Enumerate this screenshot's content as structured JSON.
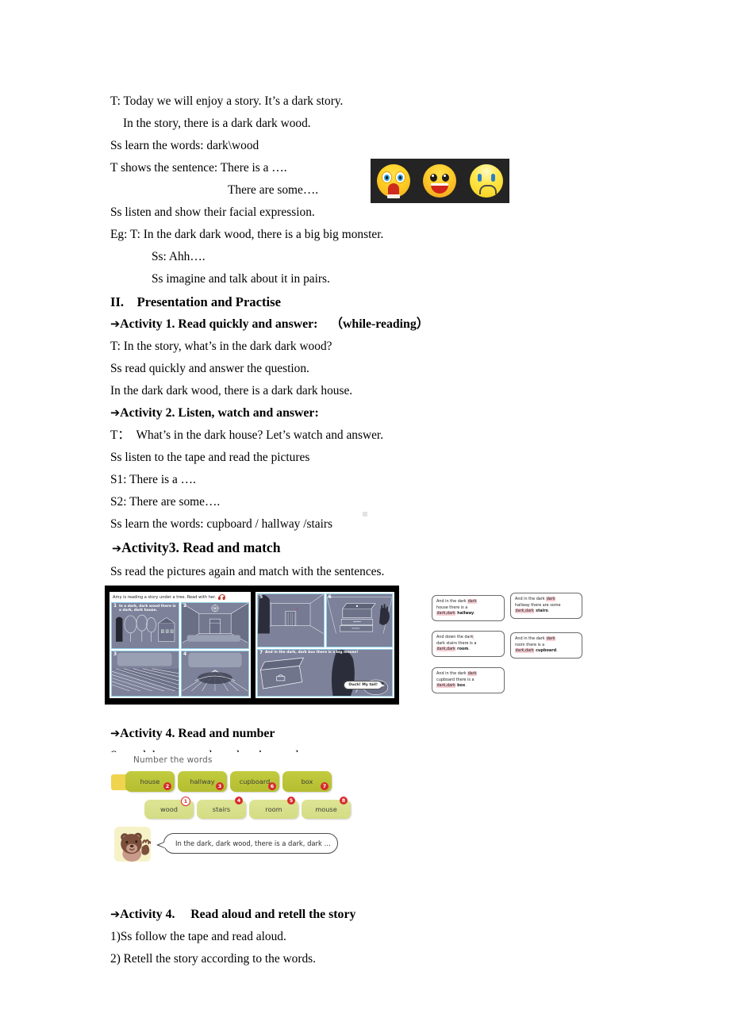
{
  "document": {
    "lines": [
      {
        "id": "l1",
        "text": "T: Today we will enjoy a story. It’s a dark story.",
        "indent": 0
      },
      {
        "id": "l2",
        "text": "In the story, there is a dark dark wood.",
        "indent": 1
      },
      {
        "id": "l3",
        "text": "Ss learn the words: dark\\wood",
        "indent": 0
      },
      {
        "id": "l4",
        "text": "T shows the sentence: There is a ….",
        "indent": 0
      },
      {
        "id": "l5",
        "text": "There are some….",
        "indent": 3
      },
      {
        "id": "l6",
        "text": "Ss listen and show their facial expression.",
        "indent": 0
      },
      {
        "id": "l7",
        "text": "Eg: T: In the dark dark wood, there is a big big monster.",
        "indent": 0
      },
      {
        "id": "l8",
        "text": "Ss: Ahh….",
        "indent": 2
      },
      {
        "id": "l9",
        "text": "Ss imagine and talk about it in pairs.",
        "indent": 2
      }
    ],
    "section_heading": "II. Presentation and Practise",
    "activity1": {
      "arrow": "➔",
      "heading": "Activity 1. Read quickly and answer: （while-reading）",
      "lines": [
        "T: In the story, what’s in the dark dark wood?",
        "Ss read quickly and answer the question.",
        "In the dark dark wood, there is a dark dark house."
      ]
    },
    "activity2": {
      "arrow": "➔",
      "heading": "Activity 2. Listen, watch and answer:",
      "lines": [
        "T： What’s in the dark house? Let’s watch and answer.",
        "Ss listen to the tape and read the pictures",
        "S1: There is a ….",
        "S2: There are some….",
        "Ss learn the words: cupboard / hallway /stairs"
      ]
    },
    "activity3": {
      "arrow": "➔",
      "heading": "Activity3. Read and match",
      "lines": [
        "Ss read the pictures again and match with the sentences."
      ]
    },
    "activity4a": {
      "arrow": "➔",
      "heading": "Activity 4. Read and number",
      "lines": [
        "Ss read the story and number the words."
      ]
    },
    "activity4b": {
      "arrow": "➔",
      "heading": "Activity 4.  Read aloud and retell the story",
      "lines": [
        "1)Ss follow the tape and read aloud.",
        "2) Retell the story according to the words."
      ]
    }
  },
  "emoji_strip": {
    "background": "#242424",
    "faces": [
      {
        "name": "screaming-face",
        "label": "screaming face"
      },
      {
        "name": "grinning-face",
        "label": "grinning face"
      },
      {
        "name": "confused-face",
        "label": "confused face"
      }
    ]
  },
  "comic": {
    "caption": "Amy is reading a story under a tree. Read with her.",
    "panels": [
      {
        "number": "1",
        "caption": "In a dark, dark wood there is a dark, dark house."
      },
      {
        "number": "2",
        "caption": ""
      },
      {
        "number": "3",
        "caption": ""
      },
      {
        "number": "4",
        "caption": ""
      },
      {
        "number": "5",
        "caption": ""
      },
      {
        "number": "6",
        "caption": ""
      },
      {
        "number": "7",
        "caption": "And in the dark, dark box there is a big mouse!"
      }
    ],
    "speech_bubble": "Ouch! My tail!"
  },
  "sentence_cards": [
    {
      "id": "card1",
      "l1_a": "And in the dark ",
      "l1_hl": "dark",
      "l2": "house there is a",
      "l3_hl": "dark,dark",
      "l3_bold": " hallway",
      "l3_end": "."
    },
    {
      "id": "card2",
      "l1_a": "And in the dark ",
      "l1_hl": "dark",
      "l2": "hallway there are some",
      "l3_hl": "dark,dark",
      "l3_bold": " stairs",
      "l3_end": "."
    },
    {
      "id": "card3",
      "l1_a": "And down the dark",
      "l1_hl": "",
      "l2": "dark stairs there is a",
      "l3_hl": "dark,dark",
      "l3_bold": " room",
      "l3_end": "."
    },
    {
      "id": "card4",
      "l1_a": "And in the dark ",
      "l1_hl": "dark",
      "l2": "room there is a",
      "l3_hl": "dark,dark",
      "l3_bold": " cupboard",
      "l3_end": "."
    },
    {
      "id": "card5",
      "l1_a": "And in the dark ",
      "l1_hl": "dark",
      "l2": "cupboard there is a",
      "l3_hl": "dark,dark",
      "l3_bold": " box",
      "l3_end": "."
    }
  ],
  "number_words": {
    "title": "Number the words",
    "row1": [
      {
        "word": "house",
        "number": "2"
      },
      {
        "word": "hallway",
        "number": "3"
      },
      {
        "word": "cupboard",
        "number": "6"
      },
      {
        "word": "box",
        "number": "7"
      }
    ],
    "row2": [
      {
        "word": "wood",
        "number": "1"
      },
      {
        "word": "stairs",
        "number": "4"
      },
      {
        "word": "room",
        "number": "5"
      },
      {
        "word": "mouse",
        "number": "8"
      }
    ],
    "speech": "In the dark, dark wood, there is a dark, dark …",
    "colors": {
      "row1_chip": "#b4be30",
      "row2_chip": "#d4dc84",
      "badge": "#d62b2b",
      "tab": "#f0d44f"
    }
  }
}
